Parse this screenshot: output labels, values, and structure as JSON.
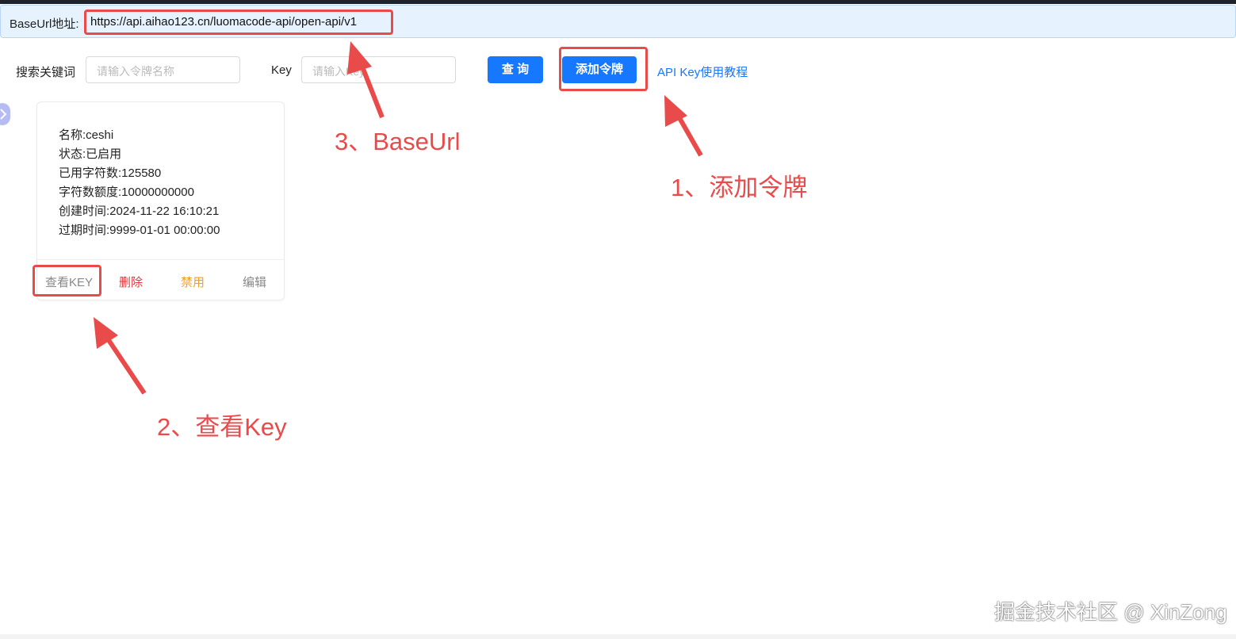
{
  "baseurl": {
    "label": "BaseUrl地址:",
    "value": "https://api.aihao123.cn/luomacode-api/open-api/v1"
  },
  "search": {
    "keyword_label": "搜索关键词",
    "keyword_placeholder": "请输入令牌名称",
    "key_label": "Key",
    "key_placeholder": "请输入Key",
    "query_button": "查 询",
    "add_button": "添加令牌",
    "tutorial_link": "API Key使用教程"
  },
  "card": {
    "lines": [
      "名称:ceshi",
      "状态:已启用",
      "已用字符数:125580",
      "字符数额度:10000000000",
      "创建时间:2024-11-22 16:10:21",
      "过期时间:9999-01-01 00:00:00"
    ],
    "actions": {
      "view_key": "查看KEY",
      "delete": "删除",
      "disable": "禁用",
      "edit": "编辑"
    }
  },
  "annotations": {
    "step1": "1、添加令牌",
    "step2": "2、查看Key",
    "step3": "3、BaseUrl",
    "color": "#e94a4a"
  },
  "watermark": "掘金技术社区 @ XinZong",
  "colors": {
    "primary": "#1677ff",
    "danger": "#e5383b",
    "warning": "#f0a020",
    "baseurl_bg": "#e6f2fd"
  }
}
